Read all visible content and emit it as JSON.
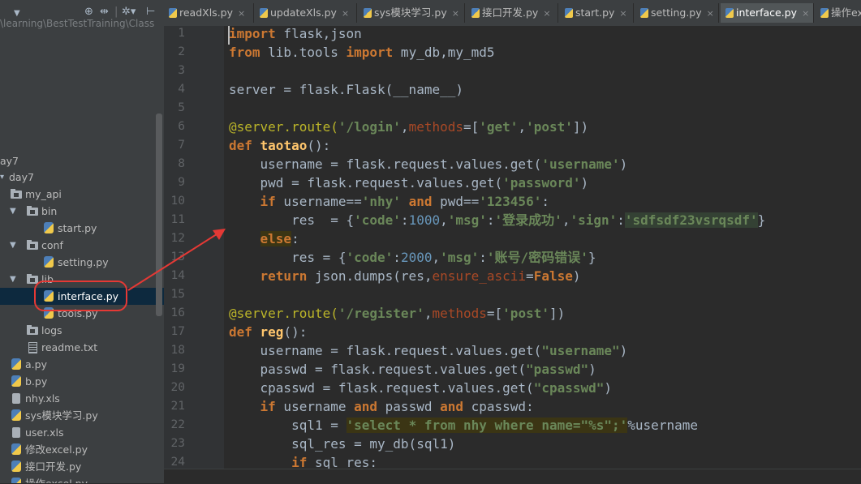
{
  "sidebar": {
    "toolbar": {
      "dropdown_icon": "chevron-down-icon",
      "target_icon": "crosshair-icon",
      "split_icon": "split-icon",
      "gear_icon": "gear-icon",
      "collapse_icon": "collapse-icon"
    },
    "path": "\\learning\\BestTestTraining\\Class",
    "items": [
      {
        "label": "ay7",
        "icon": "none"
      },
      {
        "label": "day7",
        "icon": "none"
      },
      {
        "label": "my_api",
        "icon": "folder-icon"
      },
      {
        "label": "bin",
        "icon": "folder-icon"
      },
      {
        "label": "start.py",
        "icon": "python-file-icon"
      },
      {
        "label": "conf",
        "icon": "folder-icon"
      },
      {
        "label": "setting.py",
        "icon": "python-file-icon"
      },
      {
        "label": "lib",
        "icon": "folder-icon"
      },
      {
        "label": "interface.py",
        "icon": "python-file-icon"
      },
      {
        "label": "tools.py",
        "icon": "python-file-icon"
      },
      {
        "label": "logs",
        "icon": "folder-icon"
      },
      {
        "label": "readme.txt",
        "icon": "text-file-icon"
      },
      {
        "label": "a.py",
        "icon": "python-file-icon"
      },
      {
        "label": "b.py",
        "icon": "python-file-icon"
      },
      {
        "label": "nhy.xls",
        "icon": "excel-file-icon"
      },
      {
        "label": "sys模块学习.py",
        "icon": "python-file-icon"
      },
      {
        "label": "user.xls",
        "icon": "excel-file-icon"
      },
      {
        "label": "修改excel.py",
        "icon": "python-file-icon"
      },
      {
        "label": "接口开发.py",
        "icon": "python-file-icon"
      },
      {
        "label": "操作excel.py",
        "icon": "python-file-icon"
      }
    ]
  },
  "tabs": [
    {
      "label": "readXls.py",
      "active": false
    },
    {
      "label": "updateXls.py",
      "active": false
    },
    {
      "label": "sys模块学习.py",
      "active": false
    },
    {
      "label": "接口开发.py",
      "active": false
    },
    {
      "label": "start.py",
      "active": false
    },
    {
      "label": "setting.py",
      "active": false
    },
    {
      "label": "interface.py",
      "active": true
    },
    {
      "label": "操作excel",
      "active": false
    }
  ],
  "tab_close_glyph": "×",
  "line_numbers": [
    "1",
    "2",
    "3",
    "4",
    "5",
    "6",
    "7",
    "8",
    "9",
    "10",
    "11",
    "12",
    "13",
    "14",
    "15",
    "16",
    "17",
    "18",
    "19",
    "20",
    "21",
    "22",
    "23",
    "24"
  ],
  "code": {
    "l1a": "import",
    "l1b": " flask,json",
    "l2a": "from",
    "l2b": " lib.tools ",
    "l2c": "import",
    "l2d": " my_db,my_md5",
    "l4": "server = flask.Flask(__name__)",
    "l6a": "@server.route(",
    "l6b": "'/login'",
    "l6c": ",",
    "l6d": "methods",
    "l6e": "=[",
    "l6f": "'get'",
    "l6g": ",",
    "l6h": "'post'",
    "l6i": "])",
    "l7a": "def",
    "l7b": " taotao",
    "l7c": "():",
    "l8a": "    username = flask.request.values.get(",
    "l8b": "'username'",
    "l8c": ")",
    "l9a": "    pwd = flask.request.values.get(",
    "l9b": "'password'",
    "l9c": ")",
    "l10a": "    ",
    "l10b": "if",
    "l10c": " username==",
    "l10d": "'nhy'",
    "l10e": " and",
    "l10f": " pwd==",
    "l10g": "'123456'",
    "l10h": ":",
    "l11a": "        res  = {",
    "l11b": "'code'",
    "l11c": ":",
    "l11d": "1000",
    "l11e": ",",
    "l11f": "'msg'",
    "l11g": ":",
    "l11h": "'登录成功'",
    "l11i": ",",
    "l11j": "'sign'",
    "l11k": ":",
    "l11l": "'sdfsdf23vsrqsdf'",
    "l11m": "}",
    "l12a": "    ",
    "l12b": "else",
    "l12c": ":",
    "l13a": "        res = {",
    "l13b": "'code'",
    "l13c": ":",
    "l13d": "2000",
    "l13e": ",",
    "l13f": "'msg'",
    "l13g": ":",
    "l13h": "'账号/密码错误'",
    "l13i": "}",
    "l14a": "    ",
    "l14b": "return",
    "l14c": " json.dumps(res,",
    "l14d": "ensure_ascii",
    "l14e": "=",
    "l14f": "False",
    "l14g": ")",
    "l16a": "@server.route(",
    "l16b": "'/register'",
    "l16c": ",",
    "l16d": "methods",
    "l16e": "=[",
    "l16f": "'post'",
    "l16g": "])",
    "l17a": "def",
    "l17b": " reg",
    "l17c": "():",
    "l18a": "    username = flask.request.values.get(",
    "l18b": "\"username\"",
    "l18c": ")",
    "l19a": "    passwd = flask.request.values.get(",
    "l19b": "\"passwd\"",
    "l19c": ")",
    "l20a": "    cpasswd = flask.request.values.get(",
    "l20b": "\"cpasswd\"",
    "l20c": ")",
    "l21a": "    ",
    "l21b": "if",
    "l21c": " username ",
    "l21d": "and",
    "l21e": " passwd ",
    "l21f": "and",
    "l21g": " cpasswd:",
    "l22a": "        sql1 = ",
    "l22b": "'select * from nhy where name=\"%s\";'",
    "l22c": "%username",
    "l23a": "        sql_res = my_db(sql1)",
    "l24a": "        ",
    "l24b": "if",
    "l24c": " sql_res:"
  },
  "colors": {
    "keyword": "#cc7832",
    "string": "#6a8759",
    "number": "#6897bb",
    "function": "#ffc66d",
    "annotation": "#e53935"
  }
}
